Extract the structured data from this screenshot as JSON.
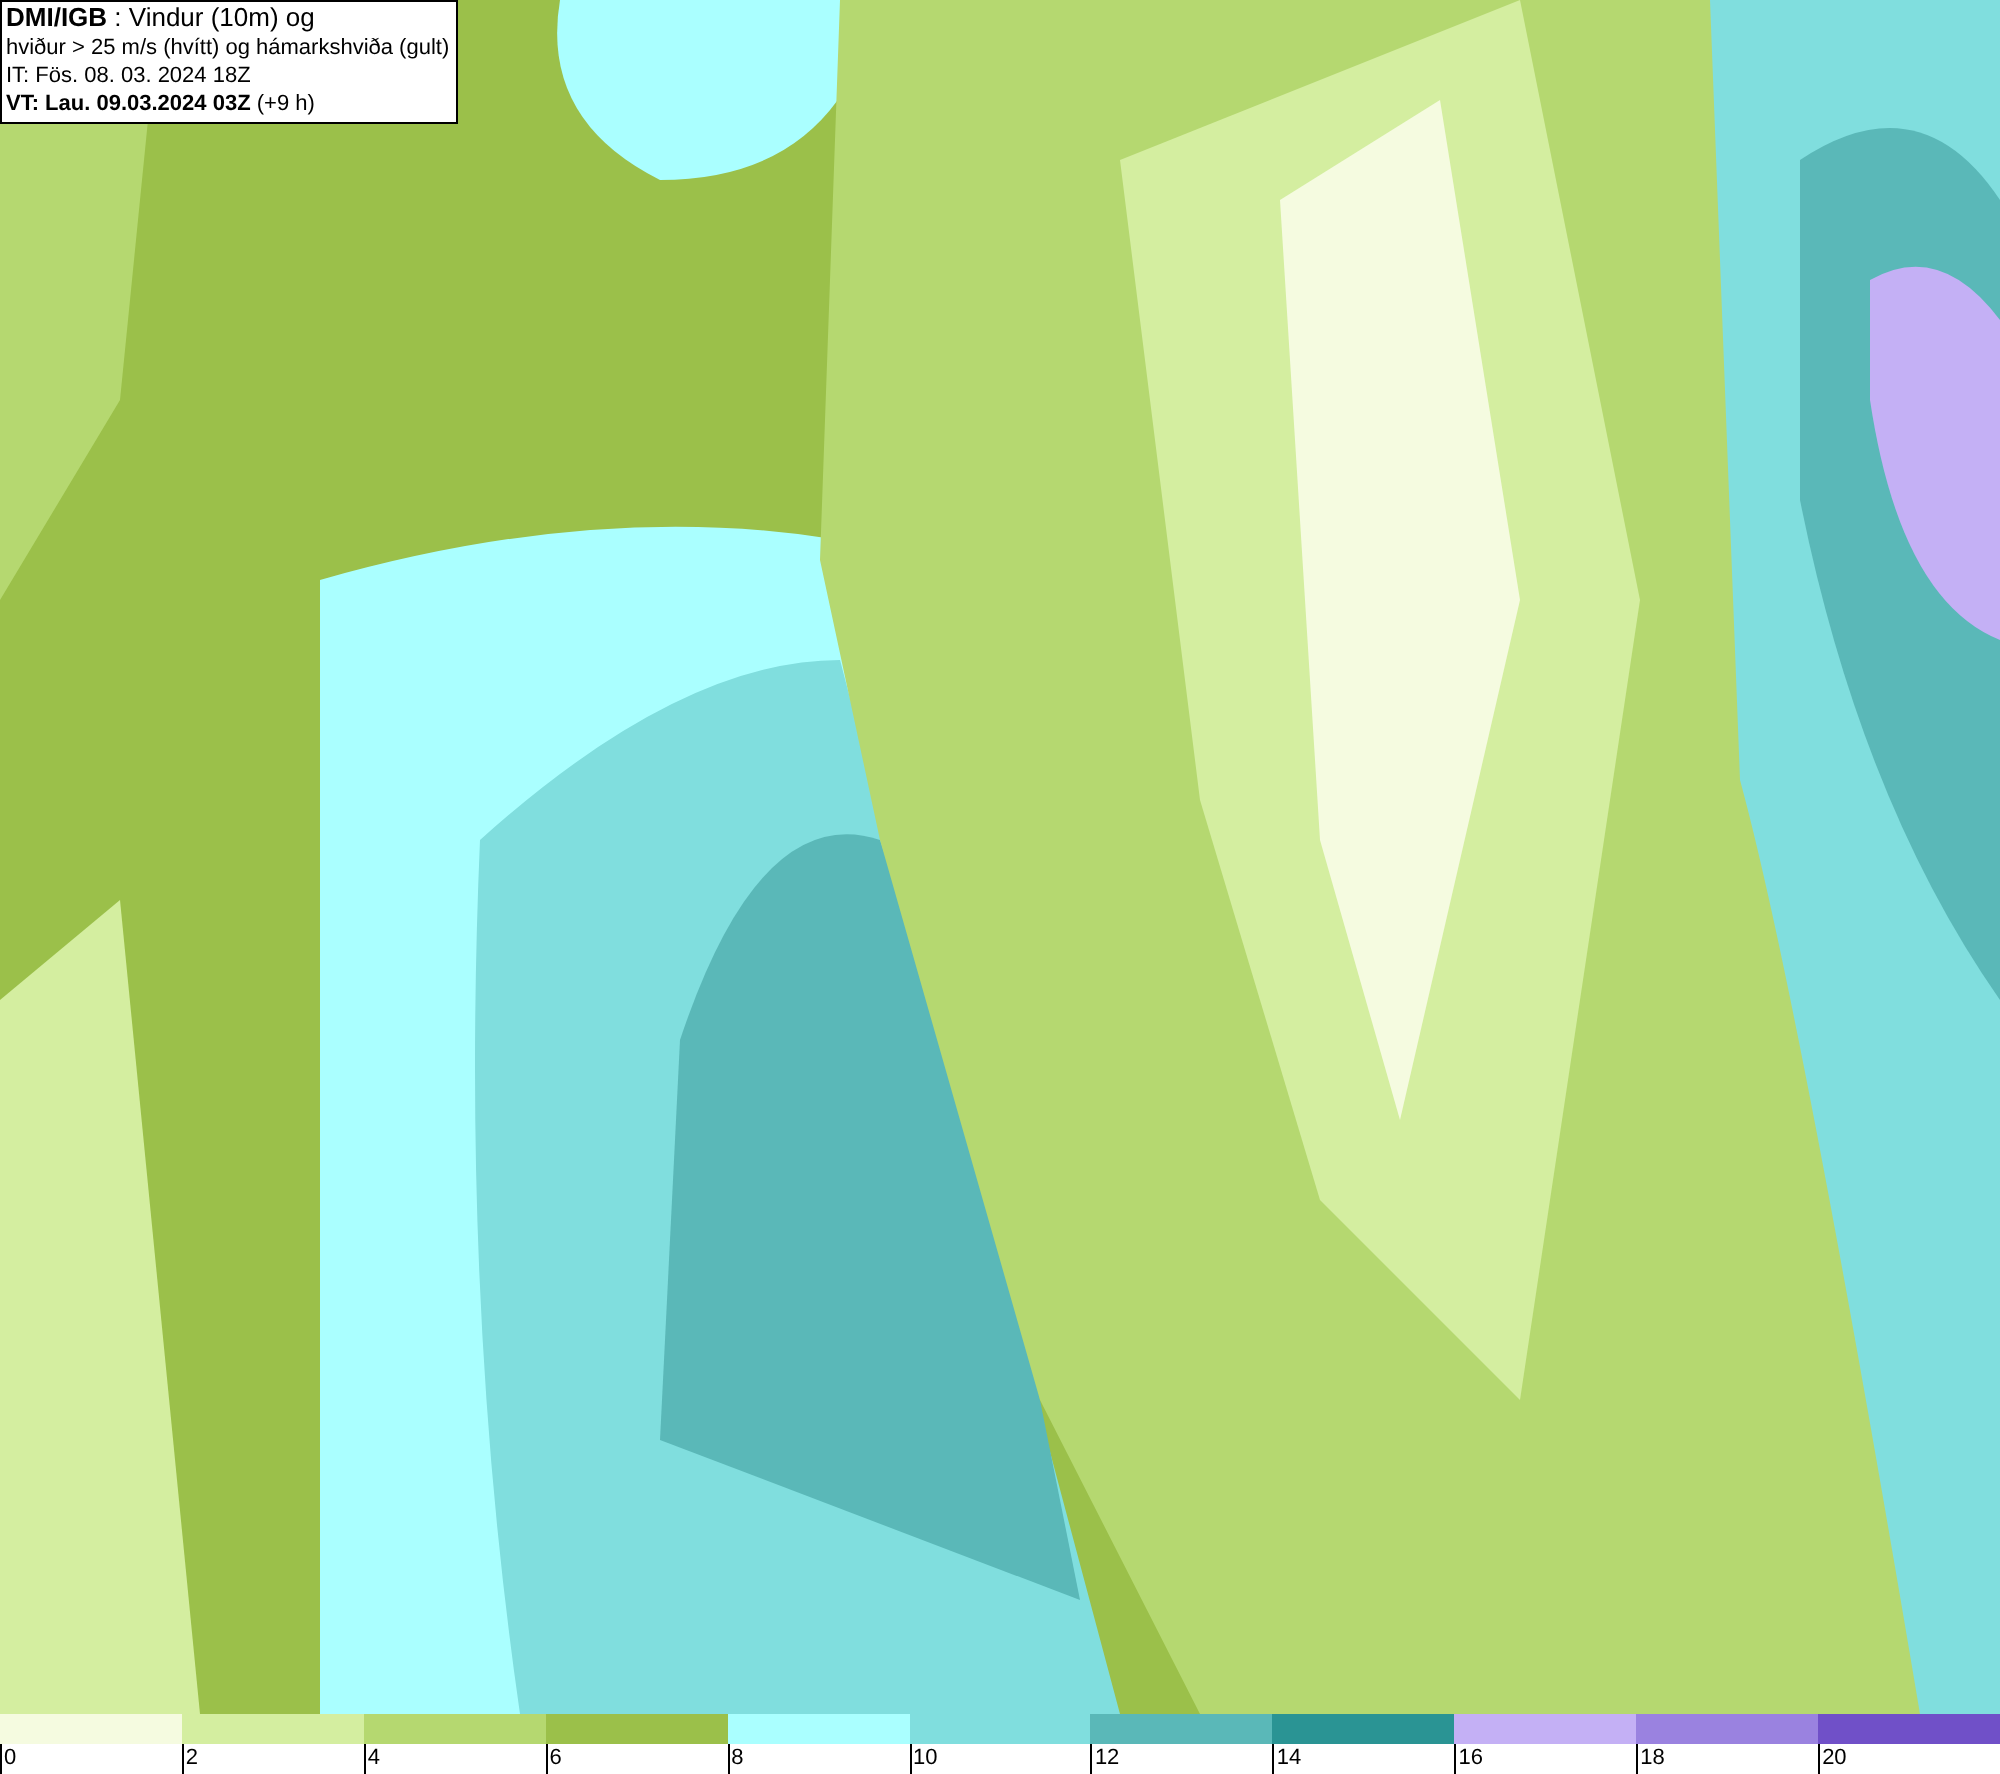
{
  "info_box": {
    "lines": [
      {
        "text": "**DMI/IGB** : Vindur (10m) og"
      },
      {
        "text": "hviður > 25 m/s (hvítt) og hámarkshviða (gult)"
      },
      {
        "text": "IT: Fös. 08. 03. 2024 18Z"
      },
      {
        "text": "**VT: Lau. 09.03.2024 03Z** (+9 h)"
      }
    ]
  },
  "legend": [
    {
      "label": "0",
      "color": "#f5fbe0"
    },
    {
      "label": "2",
      "color": "#d4eea0"
    },
    {
      "label": "4",
      "color": "#b5d870"
    },
    {
      "label": "6",
      "color": "#9bc04a"
    },
    {
      "label": "8",
      "color": "#aaffff"
    },
    {
      "label": "10",
      "color": "#80dede"
    },
    {
      "label": "12",
      "color": "#5ab8b8"
    },
    {
      "label": "14",
      "color": "#2a9494"
    },
    {
      "label": "16",
      "color": "#c4b0f5"
    },
    {
      "label": "18",
      "color": "#9a82e0"
    },
    {
      "label": "20",
      "color": "#7050c8"
    }
  ]
}
